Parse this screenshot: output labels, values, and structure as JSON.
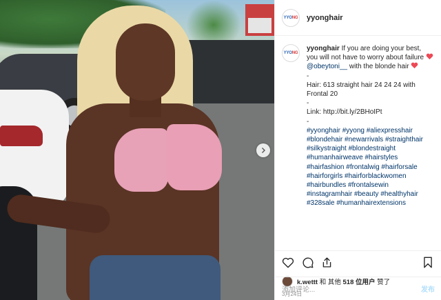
{
  "post": {
    "username": "yyonghair",
    "avatar_text_a": "YYO",
    "avatar_text_b": "NG"
  },
  "caption": {
    "username": "yyonghair",
    "line1": "If you are doing your best, you will not have to worry about failure",
    "line1_mention": "@obeytoni__",
    "line1_tail": "with the blonde hair",
    "dash1": "-",
    "hair_line": "Hair: 613 straight hair 24 24 24 with Frontal 20",
    "dash2": "-",
    "link_line": "Link: http://bit.ly/2BHoIPt",
    "dash3": "-",
    "hashtags": [
      "#yyonghair",
      "#yyong",
      "#aliexpresshair",
      "#blondehair",
      "#newarrivals",
      "#straighthair",
      "#silkystraight",
      "#blondestraight",
      "#humanhairweave",
      "#hairstyles",
      "#hairfashion",
      "#frontalwig",
      "#hairforsale",
      "#hairforgirls",
      "#hairforblackwomen",
      "#hairbundles",
      "#frontalsewin",
      "#instagramhair",
      "#beauty",
      "#healthyhair",
      "#328sale",
      "#humanhairextensions"
    ]
  },
  "likes": {
    "first_user": "k.wettt",
    "middle": "和 其他",
    "count": "518 位用户",
    "tail": "赞了"
  },
  "date": "3月24日",
  "comment_input": {
    "placeholder": "添加评论...",
    "post_label": "发布"
  },
  "colors": {
    "heart": "#ed4956",
    "link": "#003569",
    "post_button": "#b2dffc"
  },
  "icons": [
    "heart-icon",
    "comment-icon",
    "share-icon",
    "bookmark-icon",
    "chevron-right-icon"
  ]
}
